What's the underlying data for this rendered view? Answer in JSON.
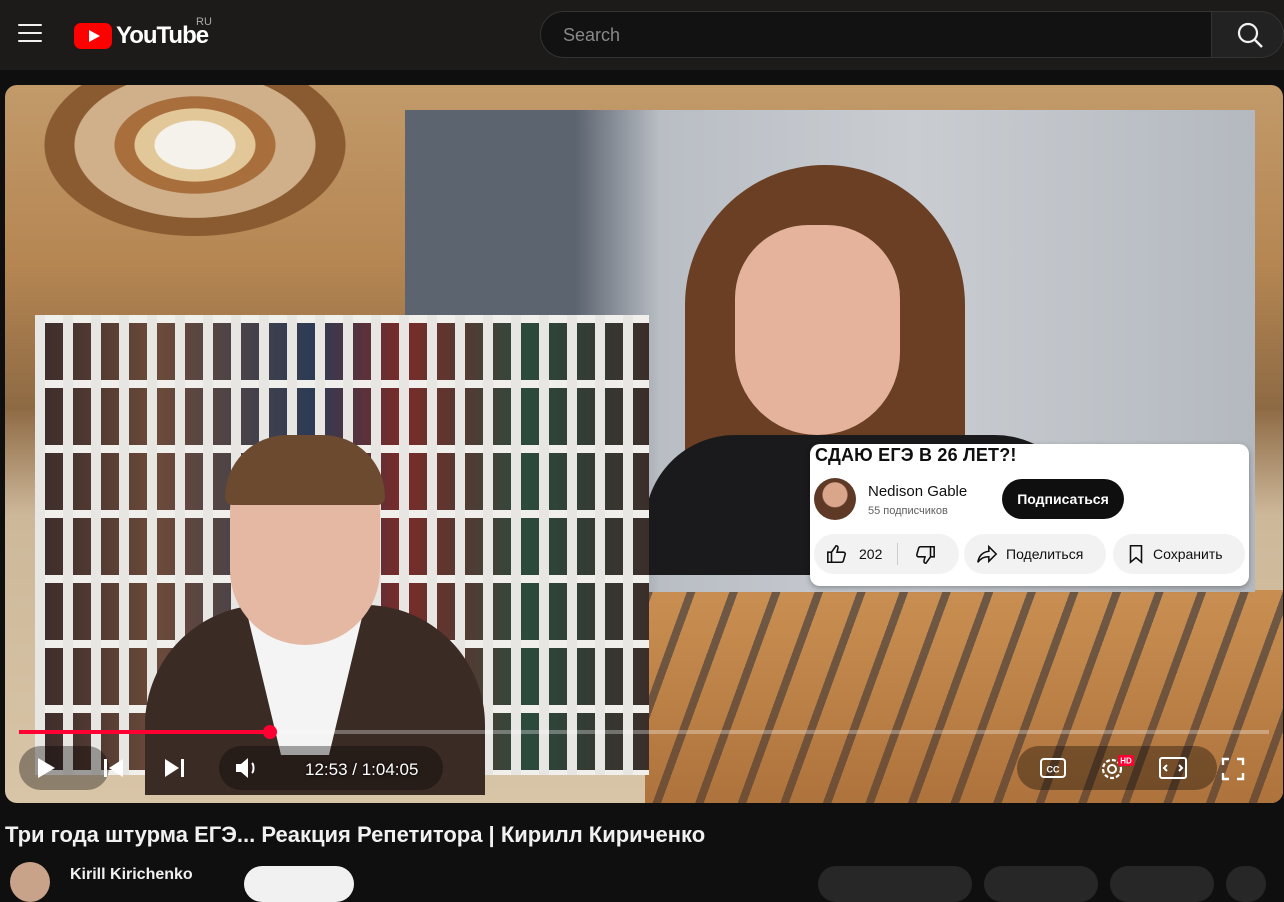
{
  "header": {
    "logo_text": "YouTube",
    "region_code": "RU",
    "search_placeholder": "Search"
  },
  "overlay_card": {
    "title": "СДАЮ ЕГЭ В 26 ЛЕТ?!",
    "channel_name": "Nedison Gable",
    "subscribers": "55 подписчиков",
    "subscribe_label": "Подписаться",
    "like_count": "202",
    "share_label": "Поделиться",
    "save_label": "Сохранить"
  },
  "player": {
    "current_time": "12:53",
    "duration": "1:04:05",
    "time_display": "12:53 / 1:04:05",
    "progress_fraction": 0.201,
    "settings_badge": "HD",
    "accent_color": "#ff0033"
  },
  "video": {
    "title": "Три года штурма ЕГЭ... Реакция Репетитора | Кирилл Кириченко",
    "channel_partial": "Kirill Kirichenko"
  },
  "icons": [
    "menu-icon",
    "youtube-logo-icon",
    "search-icon",
    "play-icon",
    "previous-icon",
    "next-icon",
    "volume-icon",
    "captions-icon",
    "settings-icon",
    "miniplayer-icon",
    "fullscreen-icon",
    "thumbs-up-icon",
    "thumbs-down-icon",
    "share-icon",
    "bookmark-icon"
  ]
}
